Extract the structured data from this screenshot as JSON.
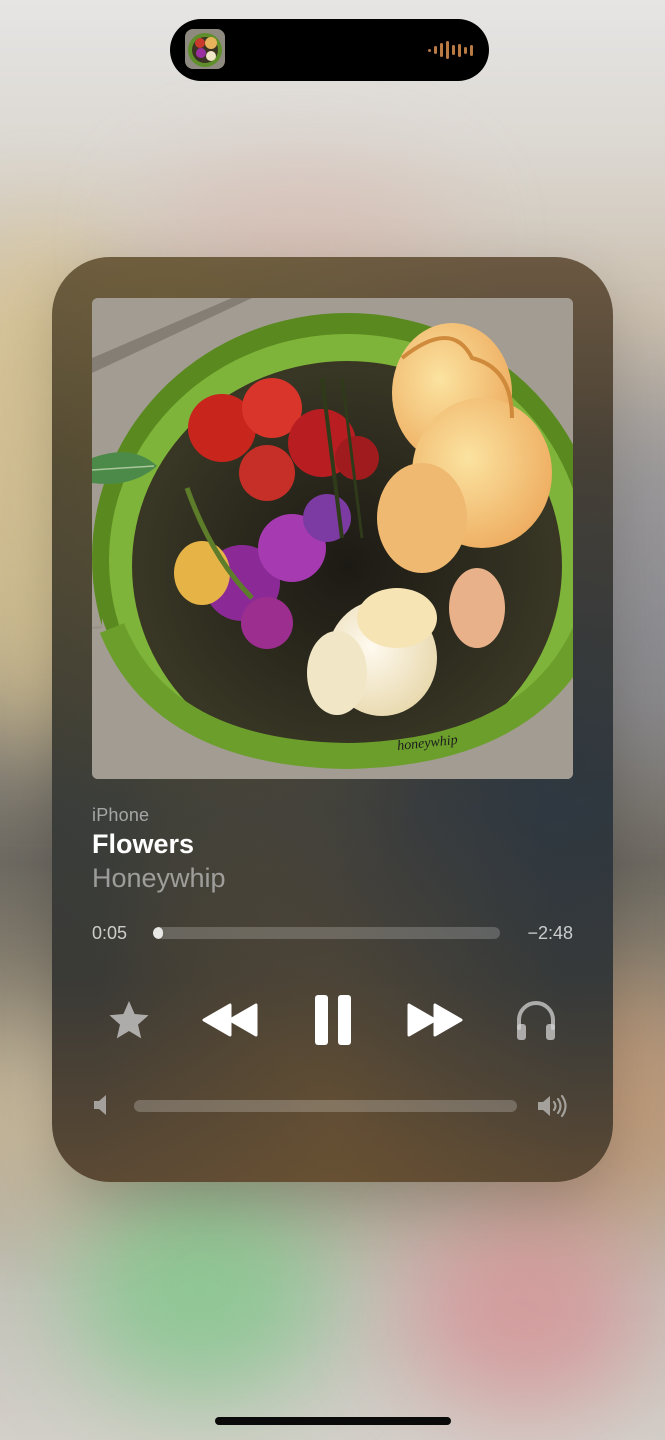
{
  "island": {
    "artwork_icon": "album-art-thumbnail",
    "activity_icon": "audio-waveform-icon",
    "accent": "#b97a44"
  },
  "player": {
    "source": "iPhone",
    "title": "Flowers",
    "artist": "Honeywhip",
    "artwork_signature": "honeywhip",
    "elapsed": "0:05",
    "remaining": "−2:48",
    "progress": 0.03,
    "volume": 0.0,
    "controls": {
      "favorite_icon": "star-icon",
      "rewind_icon": "rewind-icon",
      "pause_icon": "pause-icon",
      "forward_icon": "fast-forward-icon",
      "output_icon": "headphones-icon"
    },
    "volume_low_icon": "speaker-low-icon",
    "volume_high_icon": "speaker-high-icon"
  },
  "colors": {
    "card_top": "#6b5842",
    "card_mid": "#34383b",
    "text_primary": "#ffffff",
    "text_secondary": "#a7a39c"
  }
}
